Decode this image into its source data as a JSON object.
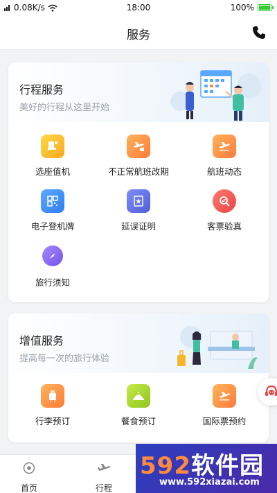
{
  "status_bar": {
    "speed": "0.08K/s",
    "time": "18:00",
    "battery": "100%"
  },
  "header": {
    "title": "服务"
  },
  "trip_card": {
    "title": "行程服务",
    "subtitle": "美好的行程从这里开始",
    "items": [
      {
        "label": "选座值机",
        "icon": "seat-checkin-icon",
        "color": "#f7b52a"
      },
      {
        "label": "不正常航班改期",
        "icon": "flight-reschedule-icon",
        "color": "#ff8a3d"
      },
      {
        "label": "航班动态",
        "icon": "flight-status-icon",
        "color": "#ff8a3d"
      },
      {
        "label": "电子登机牌",
        "icon": "qr-boarding-pass-icon",
        "color": "#3b8cf5"
      },
      {
        "label": "延误证明",
        "icon": "delay-certificate-icon",
        "color": "#5c6be0"
      },
      {
        "label": "客票验真",
        "icon": "ticket-verify-icon",
        "color": "#ea4d4d"
      },
      {
        "label": "旅行须知",
        "icon": "compass-icon",
        "color": "#7a5af0"
      }
    ]
  },
  "value_card": {
    "title": "增值服务",
    "subtitle": "提高每一次的旅行体验",
    "items": [
      {
        "label": "行李预订",
        "icon": "luggage-icon",
        "color": "#ff8a3d"
      },
      {
        "label": "餐食预订",
        "icon": "meal-icon",
        "color": "#a5d22f"
      },
      {
        "label": "国际票预约",
        "icon": "international-ticket-icon",
        "color": "#ff8a3d"
      }
    ]
  },
  "tabs": [
    {
      "label": "首页",
      "icon": "home-icon"
    },
    {
      "label": "行程",
      "icon": "plane-icon"
    }
  ],
  "watermark": {
    "brand_num": "592",
    "brand_cn": "软件园",
    "url": "www.592xiazai.com"
  }
}
